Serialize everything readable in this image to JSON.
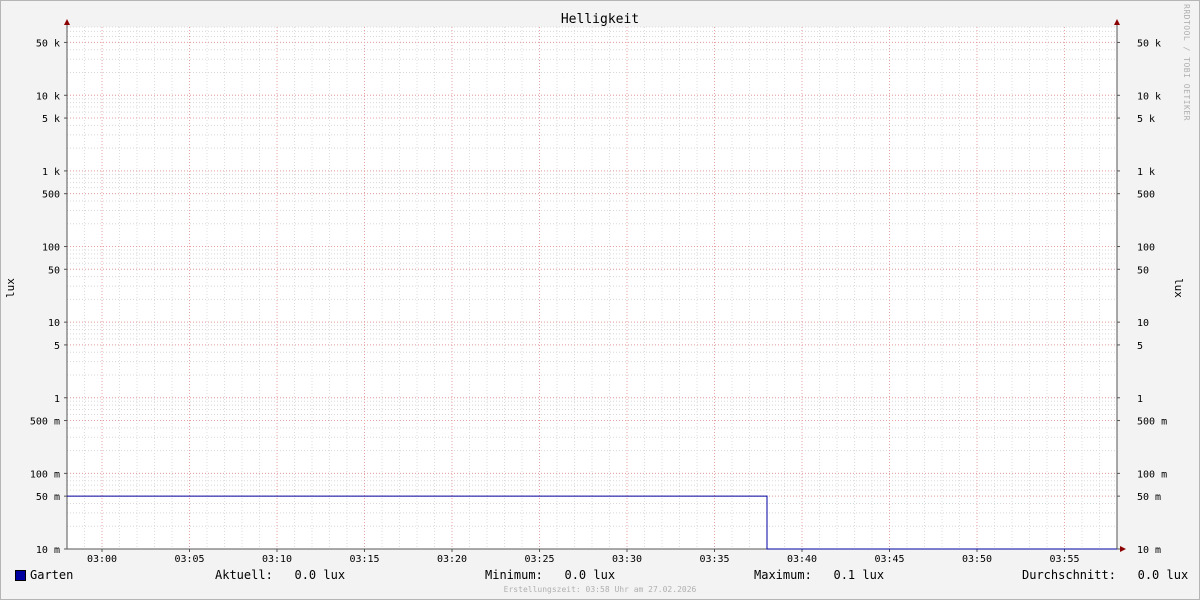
{
  "chart_data": {
    "type": "line",
    "title": "Helligkeit",
    "ylabel": "lux",
    "yscale": "log",
    "ylim": [
      0.01,
      80000
    ],
    "y_ticks": [
      {
        "value": 50000,
        "label": "50 k"
      },
      {
        "value": 10000,
        "label": "10 k"
      },
      {
        "value": 5000,
        "label": "5 k"
      },
      {
        "value": 1000,
        "label": "1 k"
      },
      {
        "value": 500,
        "label": "500"
      },
      {
        "value": 100,
        "label": "100"
      },
      {
        "value": 50,
        "label": "50"
      },
      {
        "value": 10,
        "label": "10"
      },
      {
        "value": 5,
        "label": "5"
      },
      {
        "value": 1,
        "label": "1"
      },
      {
        "value": 0.5,
        "label": "500 m"
      },
      {
        "value": 0.1,
        "label": "100 m"
      },
      {
        "value": 0.05,
        "label": "50 m"
      },
      {
        "value": 0.01,
        "label": "10 m"
      }
    ],
    "x_ticks": [
      "03:00",
      "03:05",
      "03:10",
      "03:15",
      "03:20",
      "03:25",
      "03:30",
      "03:35",
      "03:40",
      "03:45",
      "03:50",
      "03:55"
    ],
    "xlim": [
      "02:58",
      "03:58"
    ],
    "grid": true,
    "color": "#0000a0",
    "series": [
      {
        "name": "Garten",
        "points": [
          {
            "x": "02:58",
            "y": 0.05
          },
          {
            "x": "03:38",
            "y": 0.05
          },
          {
            "x": "03:38",
            "y": 0.01
          },
          {
            "x": "03:58",
            "y": 0.01
          }
        ]
      }
    ]
  },
  "legend": {
    "series_name": "Garten",
    "current": "Aktuell:   0.0 lux",
    "minimum": "Minimum:   0.0 lux",
    "maximum": "Maximum:   0.1 lux",
    "average": "Durchschnitt:   0.0 lux"
  },
  "footer": "Erstellungszeit: 03:58 Uhr am 27.02.2026",
  "watermark": "RRDTOOL / TOBI OETIKER"
}
